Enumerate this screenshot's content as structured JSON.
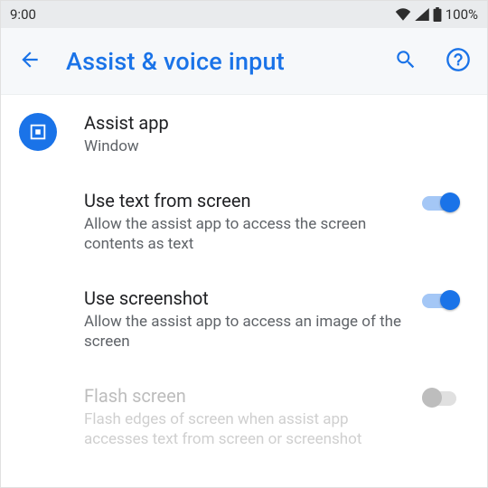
{
  "statusbar": {
    "time": "9:00",
    "battery_pct": "100%"
  },
  "appbar": {
    "title": "Assist & voice input"
  },
  "rows": {
    "assist_app": {
      "title": "Assist app",
      "subtitle": "Window"
    },
    "use_text": {
      "title": "Use text from screen",
      "subtitle": "Allow the assist app to access the screen contents as text",
      "on": true
    },
    "use_screenshot": {
      "title": "Use screenshot",
      "subtitle": "Allow the assist app to access an image of the screen",
      "on": true
    },
    "flash_screen": {
      "title": "Flash screen",
      "subtitle": "Flash edges of screen when assist app accesses text from screen or screenshot",
      "on": false,
      "disabled": true
    }
  }
}
